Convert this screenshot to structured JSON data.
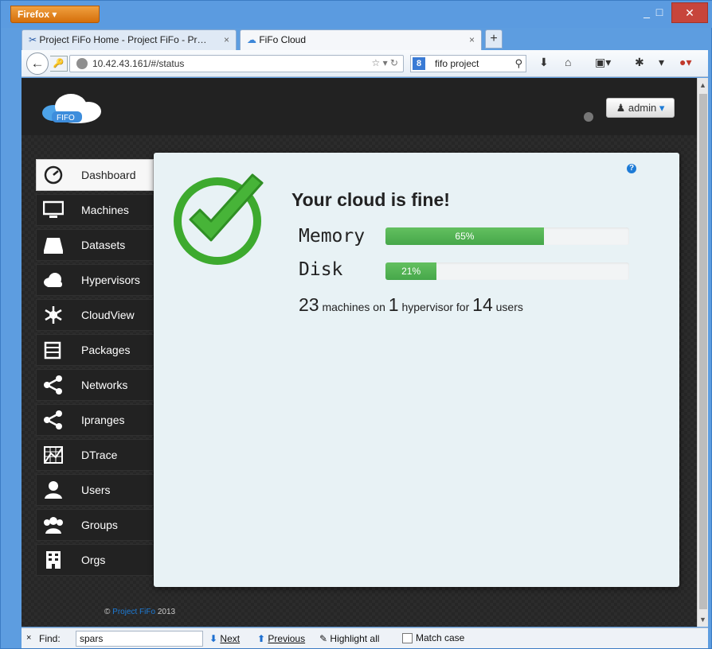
{
  "browser": {
    "menu_button": "Firefox ▾",
    "tabs": [
      {
        "title": "Project FiFo Home - Project FiFo - Pr…",
        "active": false
      },
      {
        "title": "FiFo Cloud",
        "active": true
      }
    ],
    "url": "10.42.43.161/#/status",
    "search_engine_label": "8",
    "search_text": "fifo project"
  },
  "app": {
    "logo_text": "FIFO",
    "user_menu": "admin",
    "nav": [
      {
        "label": "Dashboard",
        "icon": "dashboard-icon",
        "active": true
      },
      {
        "label": "Machines",
        "icon": "monitor-icon",
        "active": false
      },
      {
        "label": "Datasets",
        "icon": "harddisk-icon",
        "active": false
      },
      {
        "label": "Hypervisors",
        "icon": "cloud-icon",
        "active": false
      },
      {
        "label": "CloudView",
        "icon": "snowflake-icon",
        "active": false
      },
      {
        "label": "Packages",
        "icon": "package-icon",
        "active": false
      },
      {
        "label": "Networks",
        "icon": "share-icon",
        "active": false
      },
      {
        "label": "Ipranges",
        "icon": "share-icon",
        "active": false
      },
      {
        "label": "DTrace",
        "icon": "chart-icon",
        "active": false
      },
      {
        "label": "Users",
        "icon": "user-icon",
        "active": false
      },
      {
        "label": "Groups",
        "icon": "group-icon",
        "active": false
      },
      {
        "label": "Orgs",
        "icon": "building-icon",
        "active": false
      }
    ],
    "status": {
      "headline": "Your cloud is fine!",
      "memory_label": "Memory",
      "memory_percent": 65,
      "memory_text": "65%",
      "disk_label": "Disk",
      "disk_percent": 21,
      "disk_text": "21%",
      "machines_count": "23",
      "machines_text": "machines on",
      "hypervisor_count": "1",
      "hypervisor_text": "hypervisor for",
      "users_count": "14",
      "users_text": "users"
    },
    "footer": {
      "copyright_symbol": "©",
      "link": "Project FiFo",
      "year": "2013"
    }
  },
  "findbar": {
    "close": "×",
    "label": "Find:",
    "value": "spars",
    "next": "Next",
    "previous": "Previous",
    "highlight": "Highlight all",
    "match_case": "Match case"
  }
}
